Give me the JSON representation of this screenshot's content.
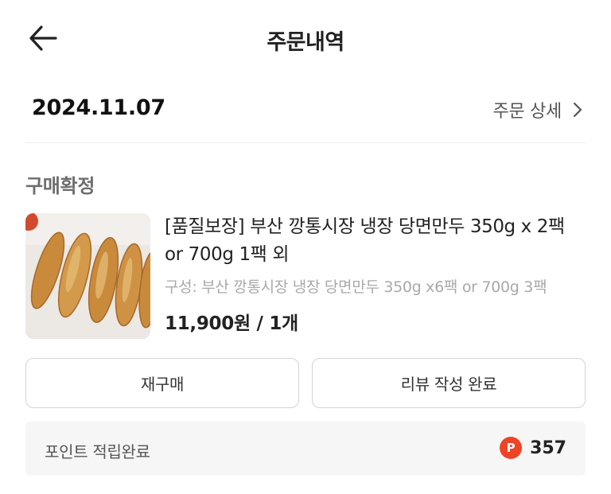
{
  "header": {
    "title": "주문내역"
  },
  "order": {
    "date": "2024.11.07",
    "detail_link": "주문 상세",
    "status": "구매확정",
    "product": {
      "name": "[품질보장] 부산 깡통시장 냉장 당면만두 350g x 2팩 or 700g 1팩 외",
      "option": "구성: 부산 깡통시장 냉장 당면만두 350g x6팩 or 700g 3팩",
      "price_line": "11,900원 / 1개"
    }
  },
  "actions": {
    "reorder": "재구매",
    "review": "리뷰 작성 완료"
  },
  "points": {
    "label": "포인트 적립완료",
    "icon_letter": "P",
    "value": "357"
  },
  "colors": {
    "accent": "#ee4426",
    "status_text": "#6e6e6e",
    "option_text": "#a9a9a9",
    "box_bg": "#f6f6f6"
  },
  "icons": {
    "back": "arrow-left-icon",
    "detail": "chevron-right-icon",
    "points": "point-badge-icon"
  }
}
